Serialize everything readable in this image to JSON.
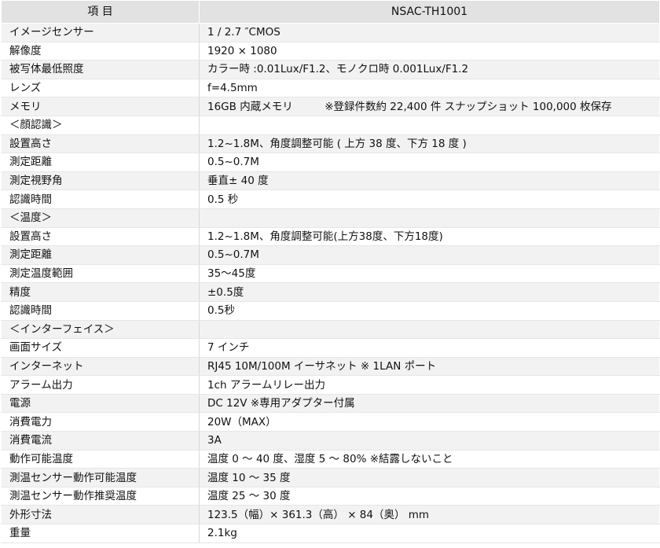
{
  "header": {
    "item": "項  目",
    "model": "NSAC-TH1001"
  },
  "rows": [
    {
      "label": "イメージセンサー",
      "value": "1 / 2.7 ″CMOS"
    },
    {
      "label": "解像度",
      "value": "1920 × 1080"
    },
    {
      "label": "被写体最低照度",
      "value": "カラー時 :0.01Lux/F1.2、モノクロ時 0.001Lux/F1.2"
    },
    {
      "label": "レンズ",
      "value": "f=4.5mm"
    },
    {
      "label": "メモリ",
      "value": "16GB 内蔵メモリ　　　※登録件数約 22,400 件  スナップショット 100,000 枚保存"
    },
    {
      "label": "＜顔認識＞",
      "value": ""
    },
    {
      "label": "設置高さ",
      "value": "1.2~1.8M、角度調整可能 ( 上方 38 度、下方 18 度 )"
    },
    {
      "label": "測定距離",
      "value": "0.5~0.7M"
    },
    {
      "label": "測定視野角",
      "value": "垂直± 40 度"
    },
    {
      "label": "認識時間",
      "value": "0.5 秒"
    },
    {
      "label": "＜温度＞",
      "value": ""
    },
    {
      "label": "設置高さ",
      "value": "1.2~1.8M、角度調整可能(上方38度、下方18度)"
    },
    {
      "label": "測定距離",
      "value": "0.5~0.7M"
    },
    {
      "label": "測定温度範囲",
      "value": "35～45度"
    },
    {
      "label": "精度",
      "value": "±0.5度"
    },
    {
      "label": "認識時間",
      "value": "0.5秒"
    },
    {
      "label": "＜インターフェイス＞",
      "value": ""
    },
    {
      "label": "画面サイズ",
      "value": "7 インチ"
    },
    {
      "label": "インターネット",
      "value": "RJ45  10M/100M イーサネット ※ 1LAN ポート"
    },
    {
      "label": "アラーム出力",
      "value": "1ch アラームリレー出力"
    },
    {
      "label": "電源",
      "value": "DC 12V  ※専用アダプター付属"
    },
    {
      "label": "消費電力",
      "value": "20W（MAX）"
    },
    {
      "label": "消費電流",
      "value": "3A"
    },
    {
      "label": "動作可能温度",
      "value": "温度 0 ～ 40 度、湿度 5 ～ 80%   ※結露しないこと"
    },
    {
      "label": "測温センサー動作可能温度",
      "value": "温度 10 ～ 35 度"
    },
    {
      "label": "測温センサー動作推奨温度",
      "value": "温度 25 ～ 30 度"
    },
    {
      "label": "外形寸法",
      "value": "123.5（幅）×  361.3（高） × 84（奥） mm"
    },
    {
      "label": "重量",
      "value": "2.1kg"
    }
  ]
}
